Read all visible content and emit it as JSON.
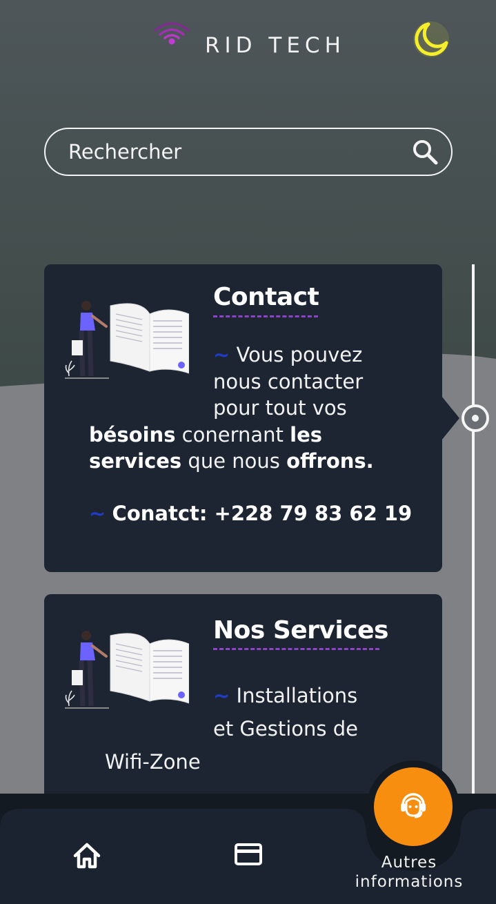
{
  "header": {
    "brand": "RID TECH"
  },
  "search": {
    "placeholder": "Rechercher"
  },
  "cards": [
    {
      "title": "Contact",
      "body_line1": "Vous pouvez",
      "body_line2": "nous contacter",
      "body_line3": "pour tout vos",
      "body_b1": "bésoins",
      "body_t1": " conernant ",
      "body_b2": "les",
      "body_b3": "services",
      "body_t2": " que nous ",
      "body_b4": "offrons.",
      "contact": "Conatct: +228 79 83 62 19",
      "tilde": "~"
    },
    {
      "title": "Nos Services",
      "body_line1": "Installations",
      "body_line2": "et Gestions de",
      "body_line3": "Wifi-Zone",
      "tilde": "~"
    }
  ],
  "bottom_nav": {
    "items": [
      {
        "icon": "home-icon"
      },
      {
        "icon": "credit-card-icon"
      },
      {
        "icon": "support-agent-icon",
        "label_line1": "Autres",
        "label_line2": "informations"
      }
    ]
  },
  "colors": {
    "card_bg": "#1d2533",
    "accent_orange": "#f88e0f",
    "moon_yellow": "#f5ee2b",
    "underline_purple": "#8e44c9",
    "tilde_blue": "#1f3cc5"
  }
}
